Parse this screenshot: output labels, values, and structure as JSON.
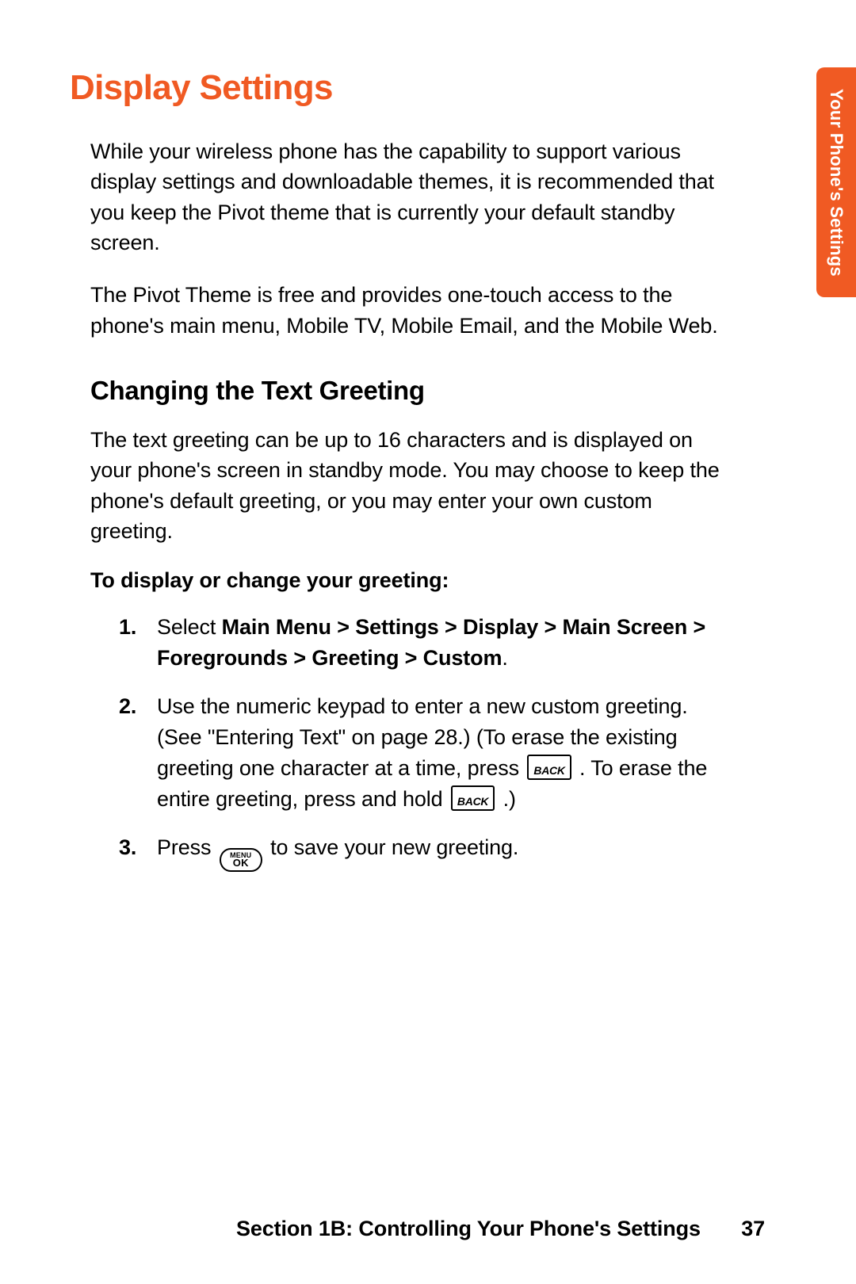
{
  "sideTab": "Your Phone's Settings",
  "title": "Display Settings",
  "para1": "While your wireless phone has the capability to support various display settings and downloadable themes, it is recommended that you keep the Pivot theme that is currently your default standby screen.",
  "para2": "The Pivot Theme is free and provides one-touch access to the phone's main menu, Mobile TV, Mobile Email, and the Mobile Web.",
  "subhead": "Changing the Text Greeting",
  "para3": "The text greeting can be up to 16 characters and is displayed on your phone's screen in standby mode. You may choose to keep the phone's default greeting, or you may enter your own custom greeting.",
  "stepHead": "To display or change your greeting:",
  "keys": {
    "back": "BACK",
    "ok_top": "MENU",
    "ok_bottom": "OK"
  },
  "steps": {
    "n1": "1.",
    "s1_a": "Select ",
    "s1_b": "Main Menu > Settings > Display > Main Screen > Foregrounds > Greeting > Custom",
    "s1_c": ".",
    "n2": "2.",
    "s2_a": "Use the numeric keypad to enter a new custom greeting. (See \"Entering Text\" on page 28.) (To erase the existing greeting one character at a time, press ",
    "s2_b": " . To erase the entire greeting, press and hold ",
    "s2_c": " .)",
    "n3": "3.",
    "s3_a": "Press ",
    "s3_b": " to save your new greeting."
  },
  "footer": {
    "label": "Section 1B: Controlling Your Phone's Settings",
    "page": "37"
  }
}
